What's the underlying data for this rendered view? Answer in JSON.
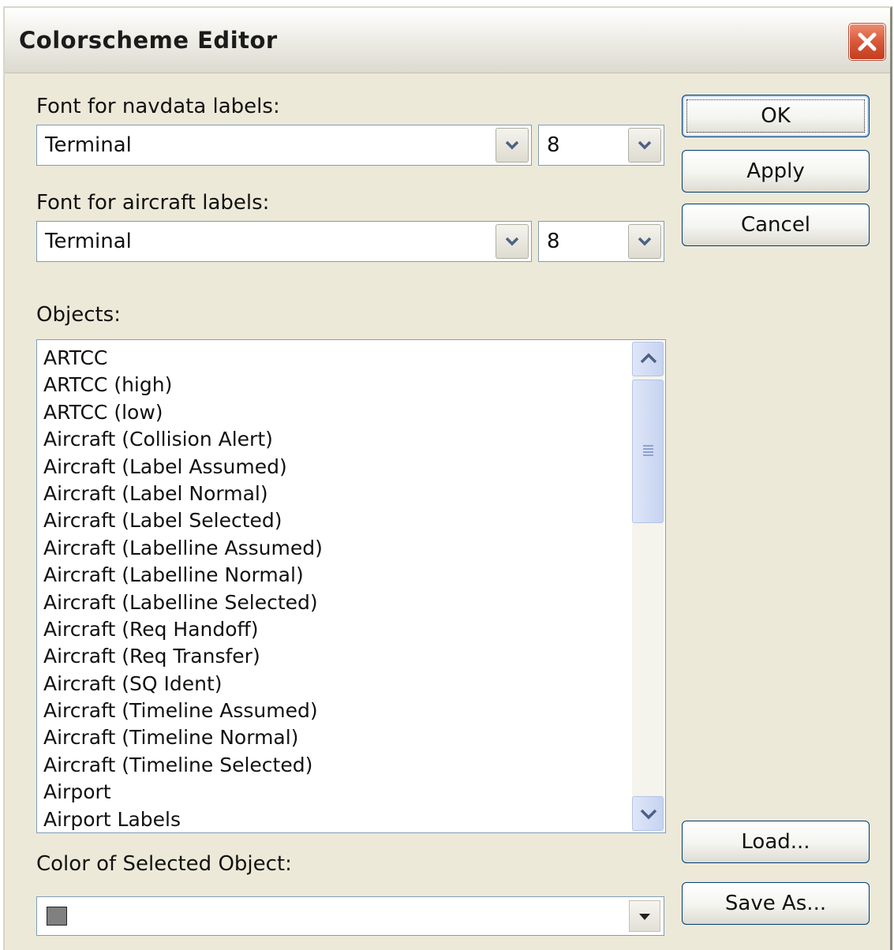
{
  "window": {
    "title": "Colorscheme Editor"
  },
  "navdata_font": {
    "label": "Font for navdata labels:",
    "font_value": "Terminal",
    "size_value": "8"
  },
  "aircraft_font": {
    "label": "Font for aircraft labels:",
    "font_value": "Terminal",
    "size_value": "8"
  },
  "buttons": {
    "ok": "OK",
    "apply": "Apply",
    "cancel": "Cancel",
    "load": "Load...",
    "save_as": "Save As..."
  },
  "objects": {
    "label": "Objects:",
    "items": [
      "ARTCC",
      "ARTCC (high)",
      "ARTCC (low)",
      "Aircraft (Collision Alert)",
      "Aircraft (Label Assumed)",
      "Aircraft (Label Normal)",
      "Aircraft (Label Selected)",
      "Aircraft (Labelline Assumed)",
      "Aircraft (Labelline Normal)",
      "Aircraft (Labelline Selected)",
      "Aircraft (Req Handoff)",
      "Aircraft (Req Transfer)",
      "Aircraft (SQ Ident)",
      "Aircraft (Timeline Assumed)",
      "Aircraft (Timeline Normal)",
      "Aircraft (Timeline Selected)",
      "Airport",
      "Airport Labels"
    ],
    "scroll_fraction": 0.0
  },
  "selected_color": {
    "label": "Color of Selected Object:",
    "swatch_color": "#808080"
  },
  "colors": {
    "dialog_bg": "#ece9d8",
    "field_border": "#7f9db9",
    "button_border": "#003c74",
    "close_red": "#d8583a"
  }
}
